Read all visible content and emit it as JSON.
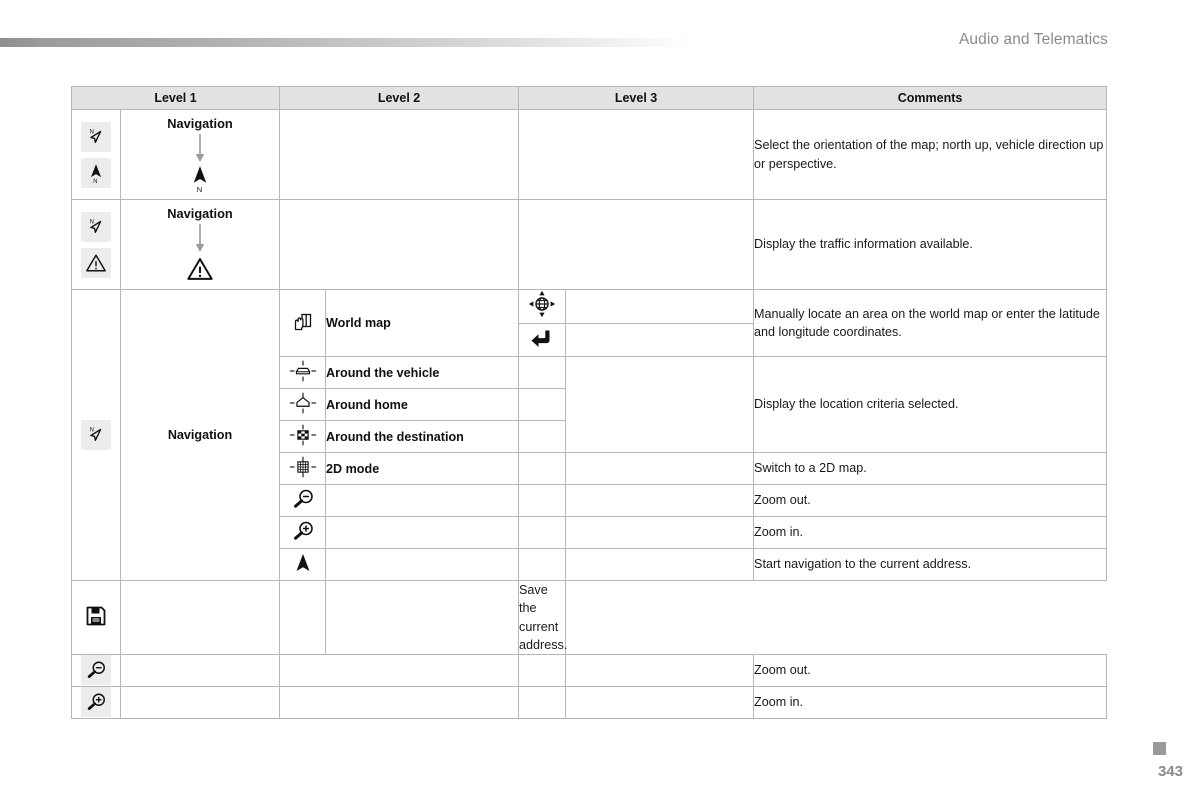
{
  "header": {
    "title": "Audio and Telematics"
  },
  "page": {
    "number": "343"
  },
  "table": {
    "columns": [
      {
        "label": "Level 1"
      },
      {
        "label": "Level 2"
      },
      {
        "label": "Level 3"
      },
      {
        "label": "Comments"
      }
    ],
    "rows": [
      {
        "id": "row-map-orientation",
        "level1_icons": [
          "perspective-north-arrow-icon",
          "north-up-arrow-icon"
        ],
        "level1_label": "Navigation",
        "flow_target_icon": "north-up-arrow-icon",
        "comment": "Select the orientation of the map; north up, vehicle direction up or perspective."
      },
      {
        "id": "row-traffic-info",
        "level1_icons": [
          "perspective-north-arrow-icon",
          "warning-triangle-icon"
        ],
        "level1_label": "Navigation",
        "flow_target_icon": "warning-triangle-icon",
        "comment": "Display the traffic information available."
      },
      {
        "id": "row-navigation-group",
        "level1_icons": [
          "perspective-north-arrow-icon"
        ],
        "level1_label": "Navigation",
        "comment_world_map": "Manually locate an area on the world map or enter the latitude and longitude coordinates.",
        "comment_location_criteria": "Display the location criteria selected.",
        "subrows": [
          {
            "id": "subrow-world-map",
            "level2_icon": "hand-on-map-icon",
            "level2_label": "World map",
            "level3_icons": [
              "globe-crosshair-icon",
              "return-arrow-icon"
            ]
          },
          {
            "id": "subrow-around-vehicle",
            "level2_icon": "around-vehicle-icon",
            "level2_label": "Around the vehicle"
          },
          {
            "id": "subrow-around-home",
            "level2_icon": "around-home-icon",
            "level2_label": "Around home"
          },
          {
            "id": "subrow-around-destination",
            "level2_icon": "around-destination-icon",
            "level2_label": "Around the destination"
          },
          {
            "id": "subrow-2d-mode",
            "level2_icon": "grid-2d-icon",
            "level2_label": "2D mode",
            "comment": "Switch to a 2D map."
          },
          {
            "id": "subrow-zoom-out",
            "level2_icon": "magnifier-minus-icon",
            "level2_label": "",
            "comment": "Zoom out."
          },
          {
            "id": "subrow-zoom-in",
            "level2_icon": "magnifier-plus-icon",
            "level2_label": "",
            "comment": "Zoom in."
          },
          {
            "id": "subrow-start-navigation",
            "level2_icon": "navigation-arrow-icon",
            "level2_label": "",
            "comment": "Start navigation to the current address."
          },
          {
            "id": "subrow-save-address",
            "level2_icon": "floppy-save-icon",
            "level2_label": "",
            "comment": "Save the current address."
          }
        ]
      },
      {
        "id": "row-zoom-out",
        "level1_icons": [
          "magnifier-minus-icon"
        ],
        "comment": "Zoom out."
      },
      {
        "id": "row-zoom-in",
        "level1_icons": [
          "magnifier-plus-icon"
        ],
        "comment": "Zoom in."
      }
    ]
  },
  "colors": {
    "header_fill": "#e2e2e2",
    "comment_fill": "#f1f2f4",
    "border": "#b6b6b6",
    "icon_chip": "#ececec",
    "header_text": "#8a8a8a",
    "page_number": "#8a8a8a",
    "arrow_grey": "#9a9a9a"
  }
}
